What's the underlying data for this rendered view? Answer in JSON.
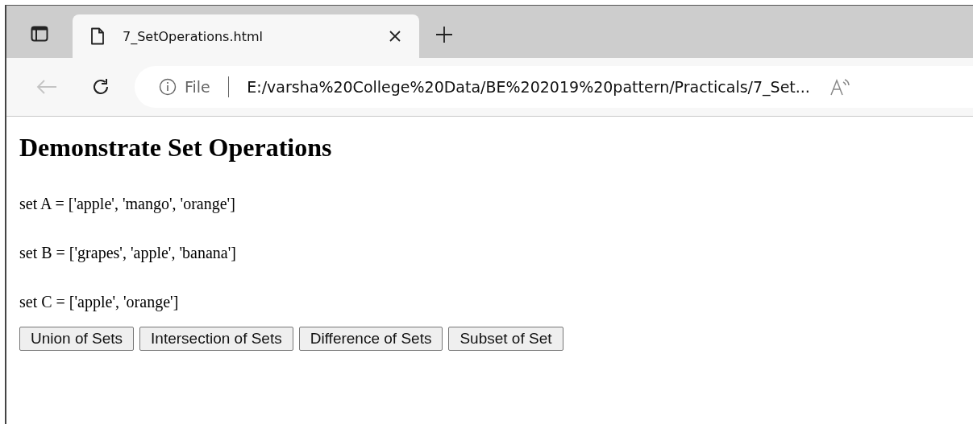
{
  "tab": {
    "title": "7_SetOperations.html",
    "selected": true
  },
  "toolbar": {
    "back_disabled": true,
    "scheme_label": "File",
    "url": "E:/varsha%20College%20Data/BE%202019%20pattern/Practicals/7_Set..."
  },
  "page": {
    "heading": "Demonstrate Set Operations",
    "lines": [
      "set A = ['apple', 'mango', 'orange']",
      "set B = ['grapes', 'apple', 'banana']",
      "set C = ['apple', 'orange']"
    ],
    "buttons": [
      "Union of Sets",
      "Intersection of Sets",
      "Difference of Sets",
      "Subset of Set"
    ]
  }
}
